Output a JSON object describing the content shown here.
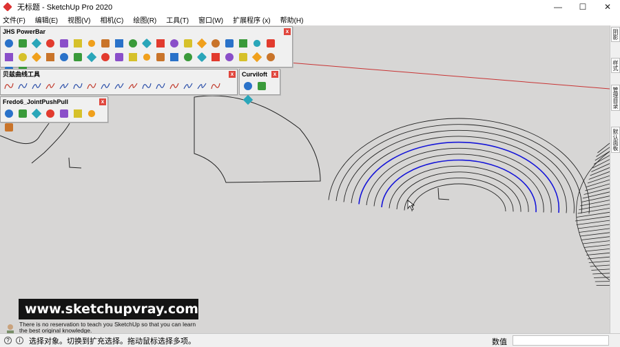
{
  "window": {
    "title": "无标题 - SketchUp Pro 2020",
    "minimize": "—",
    "maximize": "☐",
    "close": "✕"
  },
  "menu": [
    "文件(F)",
    "编辑(E)",
    "视图(V)",
    "相机(C)",
    "绘图(R)",
    "工具(T)",
    "窗口(W)",
    "扩展程序 (x)",
    "帮助(H)"
  ],
  "toolbars": {
    "jhs": {
      "title": "JHS PowerBar",
      "close": "x"
    },
    "bezier": {
      "title": "贝兹曲线工具",
      "close": "x"
    },
    "curviloft": {
      "title": "Curviloft",
      "close": "x"
    },
    "fredo": {
      "title": "Fredo6_JointPushPull",
      "close": "x"
    }
  },
  "side_tabs": [
    "阴影",
    "样式",
    "管理目录",
    "默认面板"
  ],
  "status": {
    "message": "选择对象。切换到扩充选择。拖动鼠标选择多项。",
    "vcb_label": "数值"
  },
  "watermark": {
    "url": "www.sketchupvray.com",
    "line1": "There is no reservation to teach you SketchUp so that you can learn",
    "line2": "the best original knowledge."
  },
  "colors": {
    "viewport": "#d7d6d5",
    "highlight_curve": "#1414d8",
    "axis_red": "#c83232"
  }
}
